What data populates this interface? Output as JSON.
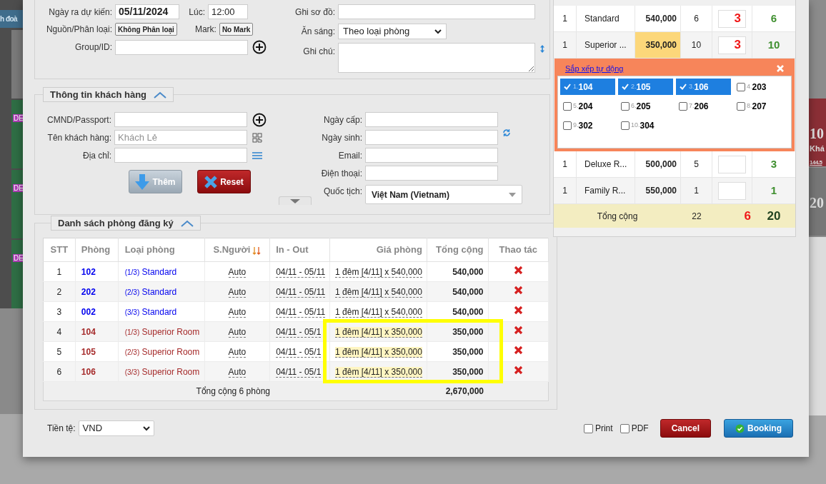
{
  "background": {
    "left_tab": "h đoà",
    "badges": [
      "DE",
      "DE",
      "DE"
    ],
    "right_cards": [
      {
        "number": "10",
        "name": "Khá",
        "amount": "144.5",
        "color": "#8b2f36"
      },
      {
        "number": "20",
        "color": "#777777"
      }
    ]
  },
  "booking": {
    "checkout_date": {
      "label": "Ngày ra dự kiến:",
      "value": "05/11/2024"
    },
    "time": {
      "label": "Lúc:",
      "value": "12:00"
    },
    "source": {
      "label": "Nguồn/Phân loại:",
      "value": "Không Phân loại"
    },
    "mark": {
      "label": "Mark:",
      "value": "No Mark"
    },
    "group": {
      "label": "Group/ID:"
    },
    "map_note": {
      "label": "Ghi sơ đồ:"
    },
    "breakfast": {
      "label": "Ăn sáng:",
      "value": "Theo loại phòng"
    },
    "note": {
      "label": "Ghi chú:"
    }
  },
  "customer": {
    "title": "Thông tin khách hàng",
    "expanded": true,
    "fields": [
      {
        "label": "CMND/Passport:",
        "kind": "add"
      },
      {
        "label": "Tên khách hàng:",
        "placeholder": "Khách Lẻ",
        "kind": "scan"
      },
      {
        "label": "Địa chỉ:",
        "kind": "list"
      }
    ],
    "buttons": [
      {
        "label": "Thêm",
        "kind": "add"
      },
      {
        "label": "Reset",
        "kind": "reset"
      }
    ],
    "right_fields": [
      {
        "label": "Ngày cấp:"
      },
      {
        "label": "Ngày sinh:"
      },
      {
        "label": "Email:"
      },
      {
        "label": "Điện thoại:"
      }
    ],
    "nationality": {
      "label": "Quốc tịch:",
      "value": "Việt Nam (Vietnam)"
    }
  },
  "rooms": {
    "title": "Danh sách phòng đăng ký",
    "expanded": true,
    "columns": [
      "STT",
      "Phòng",
      "Loại phòng",
      "S.Người",
      "In - Out",
      "Giá phòng",
      "Tổng cộng",
      "Thao tác"
    ],
    "rows": [
      {
        "stt": "1",
        "room": "102",
        "part": "(1/3)",
        "type": "Standard",
        "color": "#0000ee",
        "people": "Auto",
        "in_out": "04/11 - 05/11",
        "price": "1 đêm [4/11] x 540,000",
        "highlighted": false,
        "total": "540,000"
      },
      {
        "stt": "2",
        "room": "202",
        "part": "(2/3)",
        "type": "Standard",
        "color": "#0000ee",
        "people": "Auto",
        "in_out": "04/11 - 05/11",
        "price": "1 đêm [4/11] x 540,000",
        "highlighted": false,
        "total": "540,000"
      },
      {
        "stt": "3",
        "room": "002",
        "part": "(3/3)",
        "type": "Standard",
        "color": "#0000ee",
        "people": "Auto",
        "in_out": "04/11 - 05/11",
        "price": "1 đêm [4/11] x 540,000",
        "highlighted": false,
        "total": "540,000"
      },
      {
        "stt": "4",
        "room": "104",
        "part": "(1/3)",
        "type": "Superior Room",
        "color": "#a52a2a",
        "people": "Auto",
        "in_out": "04/11 - 05/1",
        "price": "1 đêm [4/11] x 350,000",
        "highlighted": true,
        "total": "350,000"
      },
      {
        "stt": "5",
        "room": "105",
        "part": "(2/3)",
        "type": "Superior Room",
        "color": "#a52a2a",
        "people": "Auto",
        "in_out": "04/11 - 05/1",
        "price": "1 đêm [4/11] x 350,000",
        "highlighted": true,
        "total": "350,000"
      },
      {
        "stt": "6",
        "room": "106",
        "part": "(3/3)",
        "type": "Superior Room",
        "color": "#a52a2a",
        "people": "Auto",
        "in_out": "04/11 - 05/1",
        "price": "1 đêm [4/11] x 350,000",
        "highlighted": true,
        "total": "350,000"
      }
    ],
    "summary": {
      "label": "Tổng cộng 6 phòng",
      "total": "2,670,000"
    }
  },
  "footer": {
    "currency": {
      "label": "Tiền tệ:",
      "value": "VND"
    },
    "checkboxes": [
      {
        "label": "Print",
        "checked": false
      },
      {
        "label": "PDF",
        "checked": false
      }
    ],
    "buttons": [
      {
        "label": "Cancel",
        "kind": "cancel"
      },
      {
        "label": "Booking",
        "kind": "confirm"
      }
    ]
  },
  "availability": {
    "rows": [
      {
        "qty": "1",
        "name": "Standard",
        "price": "540,000",
        "highlighted": false,
        "count": "6",
        "booked": "3",
        "available": "6"
      },
      {
        "qty": "1",
        "name": "Superior ...",
        "price": "350,000",
        "highlighted": true,
        "count": "10",
        "booked": "3",
        "available": "10"
      }
    ],
    "rows_below": [
      {
        "qty": "1",
        "name": "Deluxe R...",
        "price": "500,000",
        "highlighted": false,
        "count": "5",
        "available": "3"
      },
      {
        "qty": "1",
        "name": "Family R...",
        "price": "550,000",
        "highlighted": false,
        "count": "1",
        "available": "1"
      }
    ],
    "picker": {
      "link": "Sắp xếp tự động",
      "rooms": [
        {
          "index": "1.",
          "number": "104",
          "checked": true
        },
        {
          "index": "2.",
          "number": "105",
          "checked": true
        },
        {
          "index": "3.",
          "number": "106",
          "checked": true
        },
        {
          "index": "4.",
          "number": "203",
          "checked": false
        },
        {
          "index": "5.",
          "number": "204",
          "checked": false
        },
        {
          "index": "6.",
          "number": "205",
          "checked": false
        },
        {
          "index": "7.",
          "number": "206",
          "checked": false
        },
        {
          "index": "8.",
          "number": "207",
          "checked": false
        },
        {
          "index": "9.",
          "number": "302",
          "checked": false
        },
        {
          "index": "10.",
          "number": "304",
          "checked": false
        }
      ]
    },
    "total": {
      "label": "Tổng cộng",
      "count": "22",
      "booked": "6",
      "available": "20"
    }
  }
}
